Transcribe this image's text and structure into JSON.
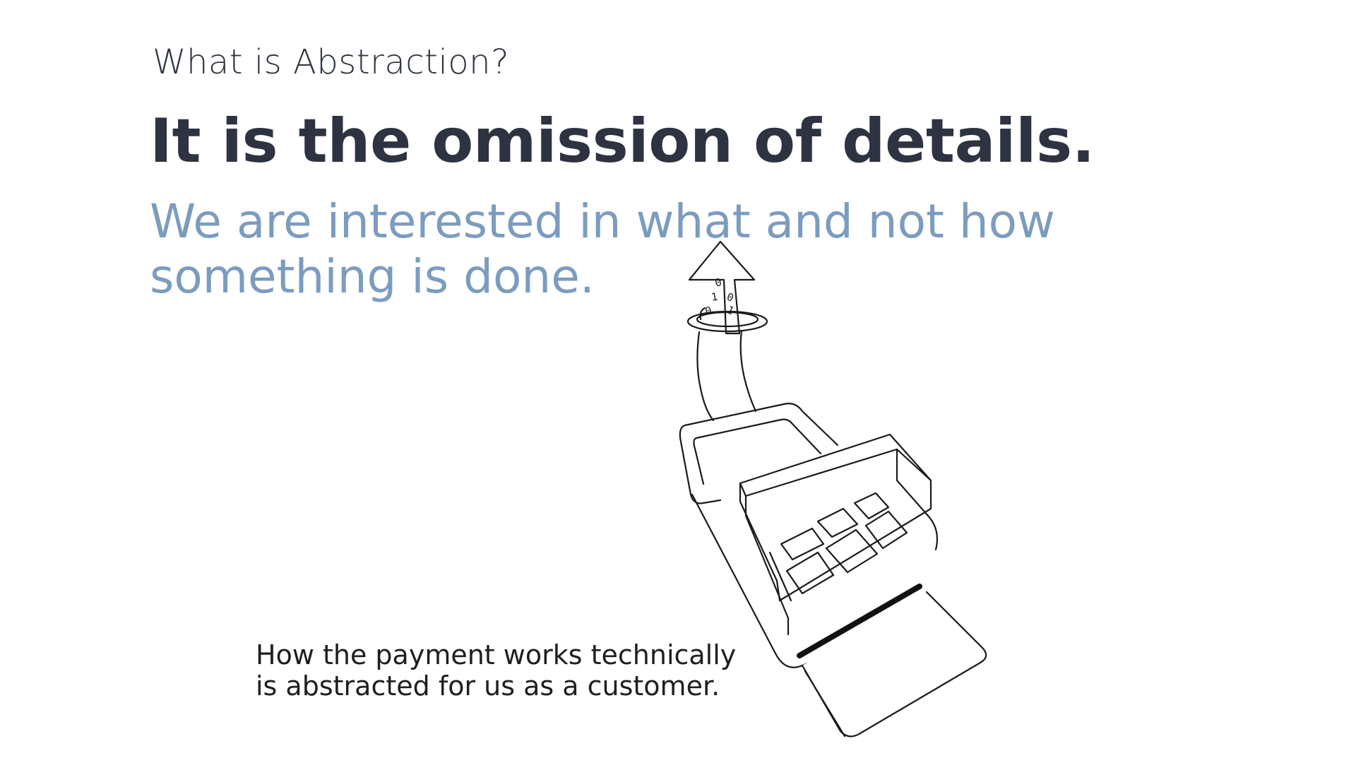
{
  "slide": {
    "eyebrow": "What is Abstraction?",
    "headline": "It is the omission of details.",
    "subheadline": "We are interested in what and not how something is done.",
    "caption": "How the payment works technically is abstracted for us as a customer."
  },
  "illustration": {
    "icon": "card-terminal-icon",
    "binary_digits": [
      "0",
      "1",
      "0",
      "0",
      "1"
    ]
  },
  "colors": {
    "headline": "#2d3340",
    "subheadline": "#7c9cbf",
    "line_art": "#1a1a1a"
  }
}
